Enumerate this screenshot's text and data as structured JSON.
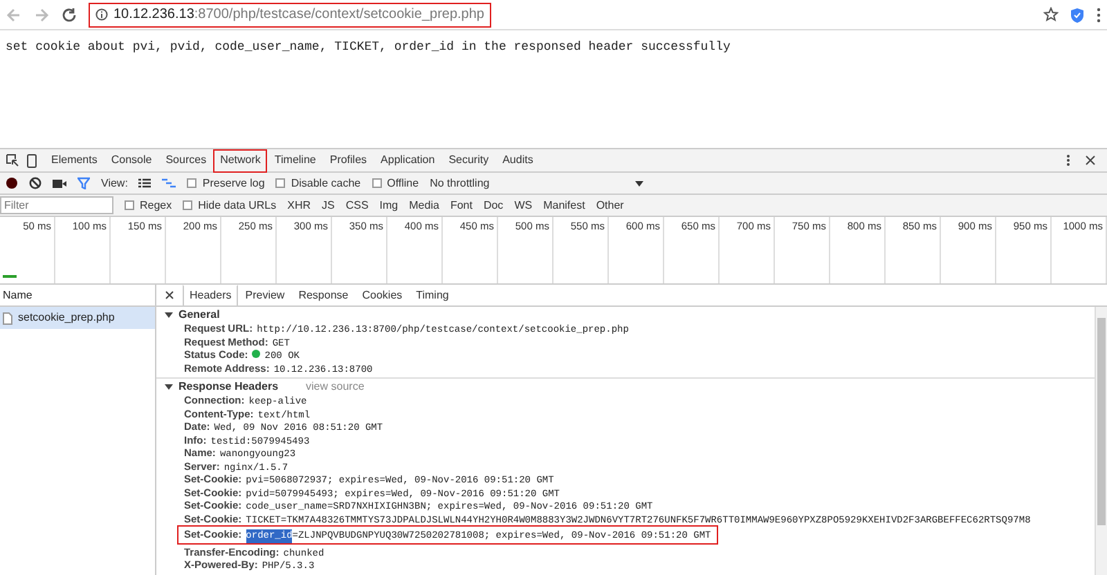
{
  "browser": {
    "url_host": "10.12.236.13",
    "url_path": ":8700/php/testcase/context/setcookie_prep.php",
    "annotated": true
  },
  "page_text": "set cookie about pvi, pvid, code_user_name, TICKET, order_id in the responsed header successfully",
  "devtools": {
    "tabs": [
      {
        "label": "Elements",
        "selected": false,
        "annotated": false
      },
      {
        "label": "Console",
        "selected": false,
        "annotated": false
      },
      {
        "label": "Sources",
        "selected": false,
        "annotated": false
      },
      {
        "label": "Network",
        "selected": true,
        "annotated": true
      },
      {
        "label": "Timeline",
        "selected": false,
        "annotated": false
      },
      {
        "label": "Profiles",
        "selected": false,
        "annotated": false
      },
      {
        "label": "Application",
        "selected": false,
        "annotated": false
      },
      {
        "label": "Security",
        "selected": false,
        "annotated": false
      },
      {
        "label": "Audits",
        "selected": false,
        "annotated": false
      }
    ],
    "toolbar": {
      "recording": true,
      "view_label": "View:",
      "options": [
        {
          "label": "Preserve log",
          "checked": false
        },
        {
          "label": "Disable cache",
          "checked": false
        },
        {
          "label": "Offline",
          "checked": false
        }
      ],
      "throttling": "No throttling"
    },
    "filter": {
      "placeholder": "Filter",
      "options": [
        {
          "label": "Regex",
          "checked": false
        },
        {
          "label": "Hide data URLs",
          "checked": false
        }
      ],
      "types": [
        "XHR",
        "JS",
        "CSS",
        "Img",
        "Media",
        "Font",
        "Doc",
        "WS",
        "Manifest",
        "Other"
      ]
    },
    "timeline_ticks": [
      "50 ms",
      "100 ms",
      "150 ms",
      "200 ms",
      "250 ms",
      "300 ms",
      "350 ms",
      "400 ms",
      "450 ms",
      "500 ms",
      "550 ms",
      "600 ms",
      "650 ms",
      "700 ms",
      "750 ms",
      "800 ms",
      "850 ms",
      "900 ms",
      "950 ms",
      "1000 ms"
    ],
    "name_header": "Name",
    "requests": [
      {
        "name": "setcookie_prep.php",
        "selected": true
      }
    ],
    "detail_tabs": [
      {
        "label": "Headers",
        "selected": true
      },
      {
        "label": "Preview",
        "selected": false
      },
      {
        "label": "Response",
        "selected": false
      },
      {
        "label": "Cookies",
        "selected": false
      },
      {
        "label": "Timing",
        "selected": false
      }
    ],
    "sections": [
      {
        "title": "General",
        "expanded": true,
        "rows": [
          {
            "key": "Request URL:",
            "value": "http://10.12.236.13:8700/php/testcase/context/setcookie_prep.php"
          },
          {
            "key": "Request Method:",
            "value": "GET"
          },
          {
            "key": "Status Code:",
            "value": "200 OK",
            "color": "#22b14c"
          },
          {
            "key": "Remote Address:",
            "value": "10.12.236.13:8700"
          }
        ]
      },
      {
        "title": "Response Headers",
        "expanded": true,
        "link": "view source",
        "rows": [
          {
            "key": "Connection:",
            "value": "keep-alive"
          },
          {
            "key": "Content-Type:",
            "value": "text/html"
          },
          {
            "key": "Date:",
            "value": "Wed, 09 Nov 2016 08:51:20 GMT"
          },
          {
            "key": "Info:",
            "value": "testid:5079945493"
          },
          {
            "key": "Name:",
            "value": "wanongyoung23"
          },
          {
            "key": "Server:",
            "value": "nginx/1.5.7"
          },
          {
            "key": "Set-Cookie:",
            "value": "pvi=5068072937; expires=Wed, 09-Nov-2016 09:51:20 GMT"
          },
          {
            "key": "Set-Cookie:",
            "value": "pvid=5079945493; expires=Wed, 09-Nov-2016 09:51:20 GMT"
          },
          {
            "key": "Set-Cookie:",
            "value": "code_user_name=SRD7NXHIXIGHN3BN; expires=Wed, 09-Nov-2016 09:51:20 GMT"
          },
          {
            "key": "Set-Cookie:",
            "value": "TICKET=TKM7A48326TMMTYS73JDPALDJSLWLN44YH2YH0R4W0M8883Y3W2JWDN6VYT7RT276UNFK5F7WR6TT0IMMAW9E960YPXZ8PO5929KXEHIVD2F3ARGBEFFEC62RTSQ97M8"
          },
          {
            "key": "Set-Cookie:",
            "selected_text": "order_id",
            "value": "=ZLJNPQVBUDGNPYUQ30W7250202781008; expires=Wed, 09-Nov-2016 09:51:20 GMT",
            "annotated": true
          },
          {
            "key": "Transfer-Encoding:",
            "value": "chunked"
          },
          {
            "key": "X-Powered-By:",
            "value": "PHP/5.3.3"
          }
        ]
      }
    ]
  }
}
